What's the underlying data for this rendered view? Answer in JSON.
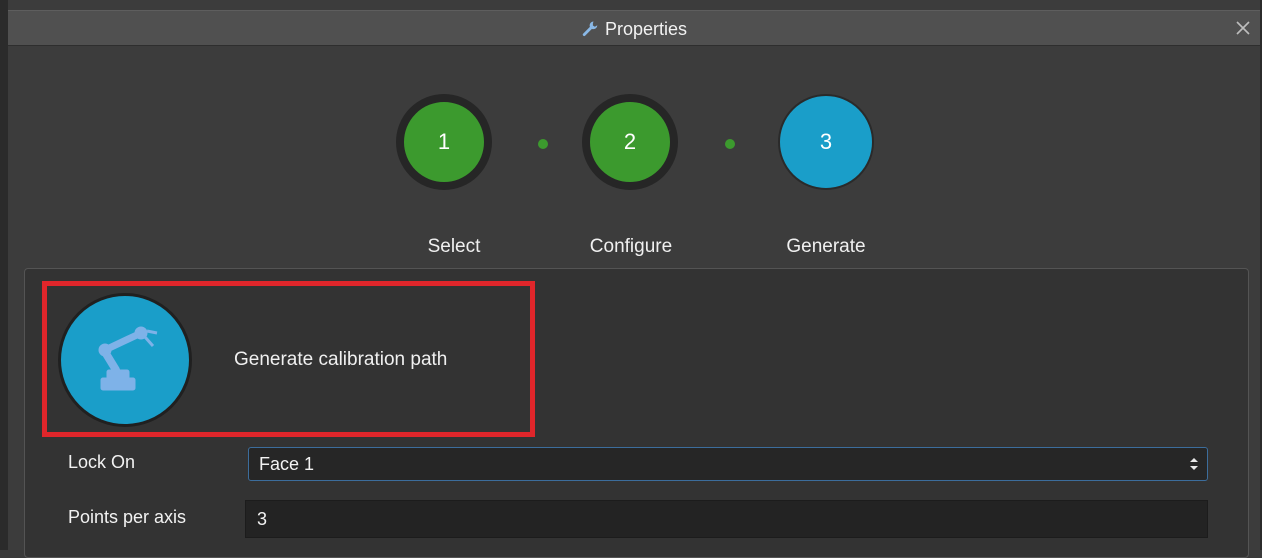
{
  "window": {
    "title": "Properties",
    "title_icon": "wrench-icon",
    "close_icon": "close-icon"
  },
  "stepper": {
    "steps": [
      {
        "number": "1",
        "label": "Select",
        "state": "done"
      },
      {
        "number": "2",
        "label": "Configure",
        "state": "done"
      },
      {
        "number": "3",
        "label": "Generate",
        "state": "active"
      }
    ]
  },
  "panel": {
    "action": {
      "icon": "robot-arm-icon",
      "label": "Generate calibration path"
    },
    "fields": {
      "lock_on": {
        "label": "Lock On",
        "value": "Face 1"
      },
      "points_per_axis": {
        "label": "Points per axis",
        "value": "3"
      }
    }
  },
  "colors": {
    "done_green": "#3c9a2e",
    "active_blue": "#1a9ec9",
    "highlight_red": "#e0262b",
    "background": "#3c3c3c"
  }
}
